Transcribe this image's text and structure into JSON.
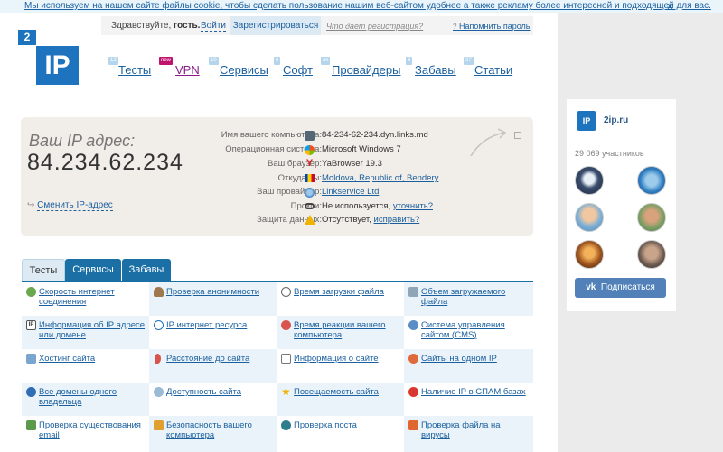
{
  "cookie_bar": {
    "text": "Мы используем на нашем сайте файлы cookie, чтобы сделать пользование нашим веб-сайтом удобнее а также рекламу более интересной и подходящей для вас.",
    "close": "×"
  },
  "header": {
    "greeting_prefix": "Здравствуйте, ",
    "greeting_name": "гость.",
    "login": "Войти",
    "register": "Зарегистрироваться",
    "what_gives": "Что дает регистрация?",
    "remind_password": "Напомнить пароль",
    "remind_q": "?"
  },
  "logo": {
    "badge": "2",
    "text": "IP"
  },
  "nav": {
    "items": [
      {
        "label": "Тесты",
        "badge": "12"
      },
      {
        "label": "VPN",
        "badge": "new"
      },
      {
        "label": "Сервисы",
        "badge": "10"
      },
      {
        "label": "Софт",
        "badge": "6"
      },
      {
        "label": "Провайдеры",
        "badge": "ok"
      },
      {
        "label": "Забавы",
        "badge": "8"
      },
      {
        "label": "Статьи",
        "badge": "27"
      }
    ]
  },
  "ip_box": {
    "title": "Ваш IP адрес:",
    "ip": "84.234.62.234",
    "change_link": "Сменить IP-адрес",
    "rows": [
      {
        "label": "Имя вашего компьютера:",
        "value": "84-234-62-234.dyn.links.md",
        "icon": "computer-icon"
      },
      {
        "label": "Операционная система:",
        "value": "Microsoft Windows 7",
        "icon": "windows-icon"
      },
      {
        "label": "Ваш браузер:",
        "value": "YaBrowser 19.3",
        "icon": "yandex-browser-icon"
      },
      {
        "label": "Откуда вы:",
        "value": "Moldova, Republic of, Bendery",
        "icon": "moldova-flag-icon"
      },
      {
        "label": "Ваш провайдер:",
        "value": "Linkservice Ltd",
        "icon": "provider-icon"
      },
      {
        "label": "Прокси:",
        "value_prefix": "Не используется, ",
        "value_link": "уточнить?",
        "icon": "glasses-icon"
      },
      {
        "label": "Защита данных:",
        "value_prefix": "Отсутствует, ",
        "value_link": "исправить?",
        "icon": "warning-icon"
      }
    ]
  },
  "tabs": [
    "Тесты",
    "Сервисы",
    "Забавы"
  ],
  "grid": [
    [
      "Скорость интернет соединения",
      "Проверка анонимности",
      "Время загрузки файла",
      "Объем загружаемого файла"
    ],
    [
      "Информация об IP адресе или домене",
      "IP интернет ресурса",
      "Время реакции вашего компьютера",
      "Система управления сайтом (CMS)"
    ],
    [
      "Хостинг сайта",
      "Расстояние до сайта",
      "Информация о сайте",
      "Сайты на одном IP"
    ],
    [
      "Все домены одного владельца",
      "Доступность сайта",
      "Посещаемость сайта",
      "Наличие IP в СПАМ базах"
    ],
    [
      "Проверка существования email",
      "Безопасность вашего компьютера",
      "Проверка поста",
      "Проверка файла на вирусы"
    ]
  ],
  "vk": {
    "name": "2ip.ru",
    "logo_text": "IP",
    "members": "29 069 участников",
    "subscribe": "Подписаться"
  },
  "colors": {
    "accent": "#1e73be",
    "link": "#1a5f9e",
    "tab_bg": "#1a6fa5",
    "vk_button": "#5181b8"
  }
}
